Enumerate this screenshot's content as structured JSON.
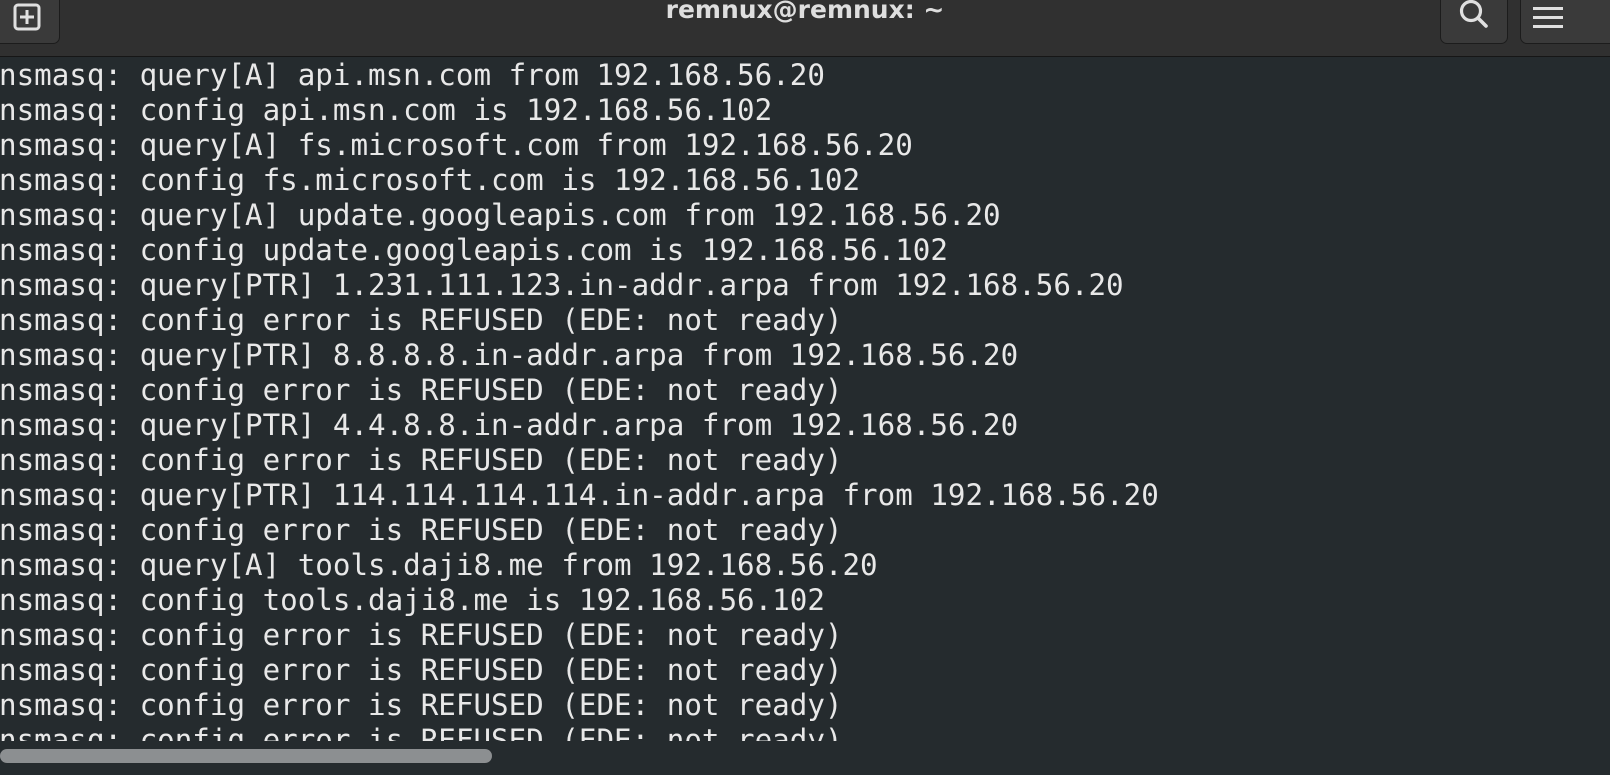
{
  "window": {
    "title": "remnux@remnux: ~"
  },
  "icons": {
    "new_tab": "new-tab-icon",
    "search": "search-icon",
    "menu": "hamburger-menu-icon"
  },
  "colors": {
    "background": "#252b2e",
    "titlebar": "#303030",
    "text": "#e8e8e8"
  },
  "terminal": {
    "lines": [
      "nsmasq: query[A] api.msn.com from 192.168.56.20",
      "nsmasq: config api.msn.com is 192.168.56.102",
      "nsmasq: query[A] fs.microsoft.com from 192.168.56.20",
      "nsmasq: config fs.microsoft.com is 192.168.56.102",
      "nsmasq: query[A] update.googleapis.com from 192.168.56.20",
      "nsmasq: config update.googleapis.com is 192.168.56.102",
      "nsmasq: query[PTR] 1.231.111.123.in-addr.arpa from 192.168.56.20",
      "nsmasq: config error is REFUSED (EDE: not ready)",
      "nsmasq: query[PTR] 8.8.8.8.in-addr.arpa from 192.168.56.20",
      "nsmasq: config error is REFUSED (EDE: not ready)",
      "nsmasq: query[PTR] 4.4.8.8.in-addr.arpa from 192.168.56.20",
      "nsmasq: config error is REFUSED (EDE: not ready)",
      "nsmasq: query[PTR] 114.114.114.114.in-addr.arpa from 192.168.56.20",
      "nsmasq: config error is REFUSED (EDE: not ready)",
      "nsmasq: query[A] tools.daji8.me from 192.168.56.20",
      "nsmasq: config tools.daji8.me is 192.168.56.102",
      "nsmasq: config error is REFUSED (EDE: not ready)",
      "nsmasq: config error is REFUSED (EDE: not ready)",
      "nsmasq: config error is REFUSED (EDE: not ready)",
      "nsmasq: config error is REFUSED (EDE: not ready)"
    ]
  }
}
